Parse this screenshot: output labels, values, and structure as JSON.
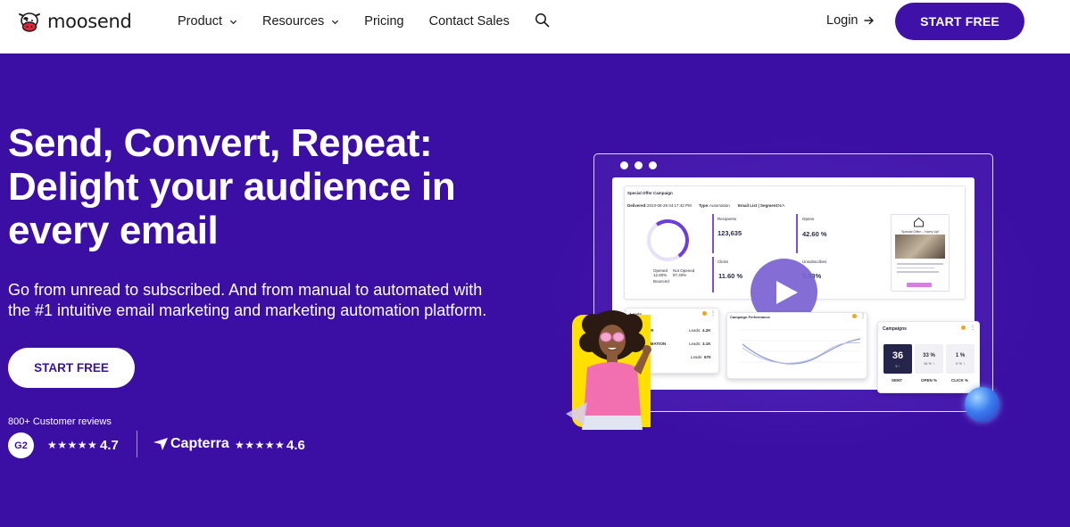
{
  "brand": {
    "name": "moosend",
    "accent": "#3f11a8",
    "hero_bg": "#3b0fa3"
  },
  "nav": {
    "items": [
      {
        "label": "Product",
        "has_dropdown": true
      },
      {
        "label": "Resources",
        "has_dropdown": true
      },
      {
        "label": "Pricing",
        "has_dropdown": false
      },
      {
        "label": "Contact Sales",
        "has_dropdown": false
      }
    ],
    "search_icon": "search-icon",
    "login_label": "Login",
    "cta_label": "START FREE"
  },
  "hero": {
    "title_lines": [
      "Send, Convert, Repeat:",
      "Delight your audience in",
      "every email"
    ],
    "subtitle_lines": [
      "Go from unread to subscribed. And from manual to automated with",
      "the #1 intuitive email marketing and marketing automation platform."
    ],
    "cta_label": "START FREE"
  },
  "reviews": {
    "label": "800+ Customer reviews",
    "g2": {
      "logo": "G2",
      "stars": "★★★★★",
      "rating": "4.7"
    },
    "capterra": {
      "name": "Capterra",
      "stars": "★★★★★",
      "rating": "4.6"
    }
  },
  "mockup": {
    "report": {
      "title": "Special Offer Campaign",
      "delivered_label": "Delivered:",
      "delivered_value": "2023-08-28 04:17:42 PM",
      "type_label": "Type:",
      "type_value": "Automation",
      "list_label": "Email List | Segment:",
      "list_value": "N/A",
      "legend": [
        "Opened",
        "12.80%",
        "Not Opened",
        "87.40%",
        "Bounced"
      ],
      "stats": [
        {
          "label": "Recipients",
          "value": "123,635"
        },
        {
          "label": "Opens",
          "value": "42.60 %"
        },
        {
          "label": "Clicks",
          "value": "11.60 %"
        },
        {
          "label": "Unsubscribes",
          "value": "0.93%"
        }
      ],
      "preview_title": "Special Offer – Hurry Up!"
    },
    "leads": {
      "title": "Leads",
      "rows": [
        {
          "name": "ZAPIER",
          "label": "Leads:",
          "value": "4.2K"
        },
        {
          "name": "AUTOMATION",
          "label": "Leads:",
          "value": "3.1K"
        },
        {
          "name": "",
          "label": "Leads:",
          "value": "670"
        }
      ]
    },
    "performance": {
      "title": "Campaign Performance"
    },
    "campaigns": {
      "title": "Campaigns",
      "boxes": [
        {
          "value": "36",
          "sub": "5 ↑",
          "label": "SENT"
        },
        {
          "value": "33 %",
          "sub": "",
          "label": "OPEN %"
        },
        {
          "value": "1 %",
          "sub": "",
          "label": "CLICK %"
        }
      ],
      "row2": [
        "16 % ↑",
        "0 % ↑"
      ]
    },
    "play_icon": "play-icon"
  }
}
